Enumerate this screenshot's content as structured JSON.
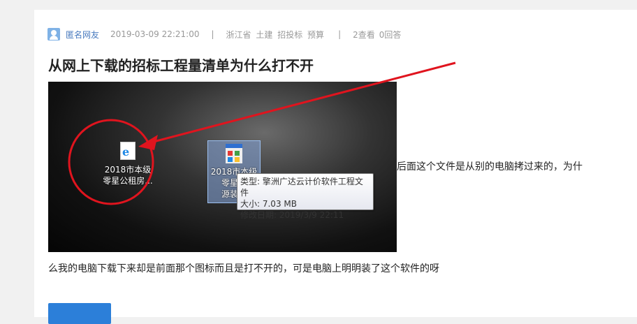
{
  "breadcrumb": {
    "text": ""
  },
  "question": {
    "author": "匿名网友",
    "datetime": "2019-03-09 22:21:00",
    "separator": "|",
    "tags": [
      "浙江省",
      "土建",
      "招投标",
      "预算"
    ],
    "views": "2查看",
    "answers": "0回答",
    "title": "从网上下载的招标工程量清单为什么打不开",
    "side_text": "后面这个文件是从别的电脑拷过来的，为什",
    "body_text": "么我的电脑下载下来却是前面那个图标而且是打不开的，可是电脑上明明装了这个软件的呀"
  },
  "screenshot": {
    "icon1_label_line1": "2018市本级",
    "icon1_label_line2": "零星公租房...",
    "icon2_label_line1": "2018市本级",
    "icon2_label_line2": "零星公",
    "icon2_label_line3": "源装修",
    "tooltip_type": "类型: 擎洲广达云计价软件工程文件",
    "tooltip_size": "大小: 7.03 MB",
    "tooltip_date": "修改日期: 2019/3/9 22:11",
    "annotation_color": "#e0141e"
  }
}
